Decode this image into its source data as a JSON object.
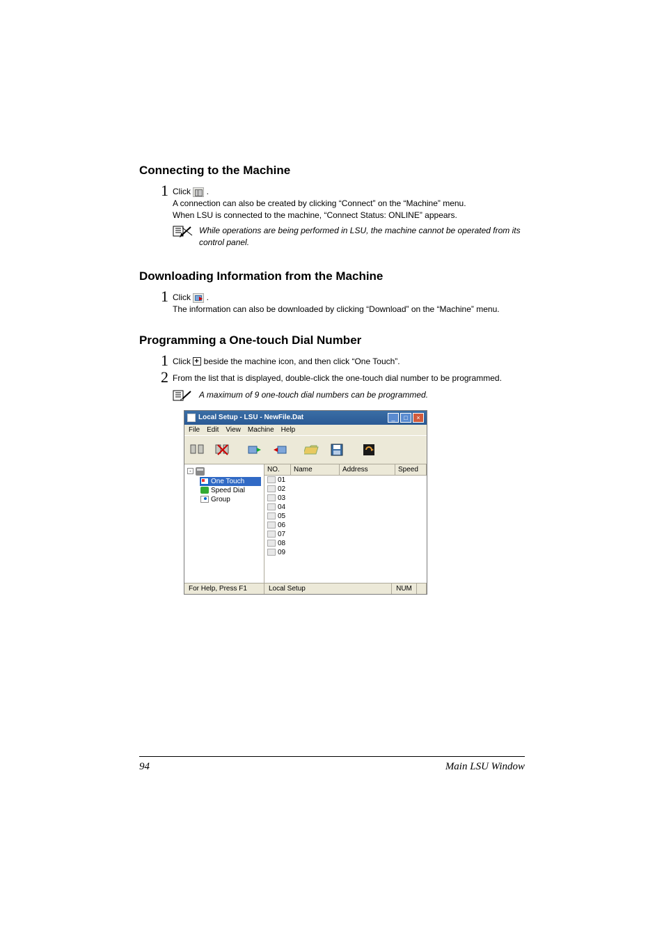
{
  "sections": {
    "connect": {
      "heading": "Connecting to the Machine",
      "step1_prefix": "Click ",
      "step1_suffix": " .",
      "step1_para1": "A connection can also be created by clicking “Connect” on the “Machine” menu.",
      "step1_para2": "When LSU is connected to the machine, “Connect Status: ONLINE” appears.",
      "note": "While operations are being performed in LSU, the machine cannot be operated from its control panel."
    },
    "download": {
      "heading": "Downloading Information from the Machine",
      "step1_prefix": "Click ",
      "step1_suffix": " .",
      "step1_para1": "The information can also be downloaded by clicking “Download” on the “Machine” menu."
    },
    "onetouch": {
      "heading": "Programming a One-touch Dial Number",
      "step1_prefix": "Click ",
      "step1_mid": " beside the machine icon, and then click “One Touch”.",
      "step2": "From the list that is displayed, double-click the one-touch dial number to be programmed.",
      "note": "A maximum of 9 one-touch dial numbers can be programmed."
    }
  },
  "app_window": {
    "title": "Local Setup - LSU - NewFile.Dat",
    "menu": [
      "File",
      "Edit",
      "View",
      "Machine",
      "Help"
    ],
    "tree": {
      "items": [
        {
          "label": "One Touch",
          "selected": true
        },
        {
          "label": "Speed Dial",
          "selected": false
        },
        {
          "label": "Group",
          "selected": false
        }
      ]
    },
    "columns": {
      "no": "NO.",
      "name": "Name",
      "address": "Address",
      "speed": "Speed"
    },
    "rows": [
      "01",
      "02",
      "03",
      "04",
      "05",
      "06",
      "07",
      "08",
      "09"
    ],
    "status": {
      "help": "For Help, Press F1",
      "mode": "Local Setup",
      "num": "NUM"
    }
  },
  "footer": {
    "page": "94",
    "title": "Main LSU Window"
  }
}
